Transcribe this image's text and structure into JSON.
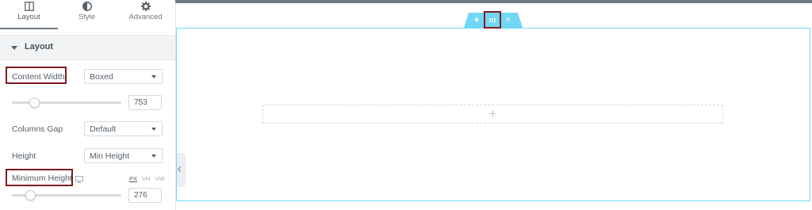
{
  "tabs": [
    {
      "label": "Layout",
      "icon": "columns-icon",
      "active": true
    },
    {
      "label": "Style",
      "icon": "half-circle-icon",
      "active": false
    },
    {
      "label": "Advanced",
      "icon": "gear-icon",
      "active": false
    }
  ],
  "section": {
    "title": "Layout"
  },
  "content_width": {
    "label": "Content Width",
    "value": "Boxed"
  },
  "width_slider": {
    "value": "753",
    "fraction": 0.2
  },
  "columns_gap": {
    "label": "Columns Gap",
    "value": "Default"
  },
  "height": {
    "label": "Height",
    "value": "Min Height"
  },
  "min_height": {
    "label": "Minimum Height",
    "icon": "desktop-icon",
    "units": [
      "PX",
      "VH",
      "VW"
    ],
    "selected_unit": "PX",
    "value": "276",
    "fraction": 0.17
  },
  "canvas": {
    "handle_buttons": [
      "add-section",
      "edit-section",
      "delete-section"
    ],
    "add_symbol": "+",
    "close_symbol": "×",
    "empty_column_symbol": "+"
  },
  "colors": {
    "accent": "#71d7f7",
    "highlight": "#7b1d20",
    "topbar": "#6d7882"
  }
}
